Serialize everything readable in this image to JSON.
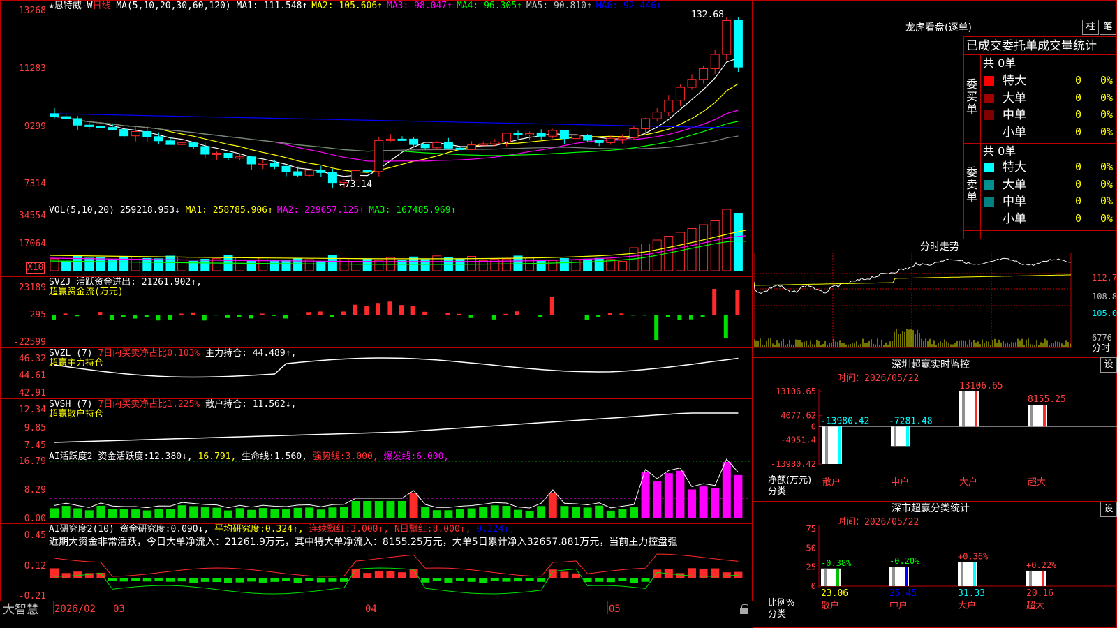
{
  "colors": {
    "up": "#ff2a2a",
    "down": "#00ffff",
    "grid": "#c00000",
    "ma1": "#ffffff",
    "ma2": "#ffff00",
    "ma3": "#ff00ff",
    "ma4": "#00ff00",
    "ma5": "#808080",
    "ma6": "#0000ff"
  },
  "main": {
    "star_title": "★思特威-W",
    "period": "日线",
    "ma_params": "MA(5,10,20,30,60,120)",
    "ma": [
      {
        "label": "MA1:",
        "value": "111.548↑",
        "color": "#ffffff"
      },
      {
        "label": "MA2:",
        "value": "105.606↑",
        "color": "#ffff00"
      },
      {
        "label": "MA3:",
        "value": "98.047↑",
        "color": "#ff00ff"
      },
      {
        "label": "MA4:",
        "value": "96.305↑",
        "color": "#00ff00"
      },
      {
        "label": "MA5:",
        "value": "90.810↑",
        "color": "#c0c0c0"
      },
      {
        "label": "MA6:",
        "value": "92.446↑",
        "color": "#0000ff"
      }
    ],
    "axis": [
      "13268",
      "11283",
      "9299",
      "7314"
    ],
    "high_label": "132.68",
    "low_label": "←73.14"
  },
  "vol": {
    "name": "VOL(5,10,20)",
    "value": "259218.953↓",
    "ma": [
      {
        "label": "MA1:",
        "value": "258785.906↑",
        "color": "#ffff00"
      },
      {
        "label": "MA2:",
        "value": "229657.125↑",
        "color": "#ff00ff"
      },
      {
        "label": "MA3:",
        "value": "167485.969↑",
        "color": "#00ff00"
      }
    ],
    "axis": [
      "34554",
      "17064"
    ],
    "unit": "X10"
  },
  "svzj": {
    "name": "SVZJ",
    "label": "活跃资金进出:",
    "value": "21261.902↑,",
    "sub": "超赢资金流(万元)",
    "axis": [
      "23189",
      "295",
      "-22599"
    ]
  },
  "svzl": {
    "name": "SVZL  (7)",
    "pct": "7日内买卖净占比0.103%",
    "label": "主力持仓:",
    "value": "44.489↑,",
    "sub": "超赢主力持仓",
    "axis": [
      "46.32",
      "44.61",
      "42.91"
    ]
  },
  "svsh": {
    "name": "SVSH  (7)",
    "pct": "7日内买卖净占比1.225%",
    "label": "散户持仓:",
    "value": "11.562↓,",
    "sub": "超赢散户持仓",
    "axis": [
      "12.34",
      "9.85",
      "7.45"
    ]
  },
  "ai1": {
    "name": "AI活跃度2",
    "l1": "资金活跃度:",
    "v1": "12.380↓,",
    "v2": "16.791,",
    "l3": "生命线:",
    "v3": "1.560,",
    "l4": "强势线:",
    "v4": "3.000,",
    "l5": "爆发线:",
    "v5": "6.000,",
    "axis": [
      "16.79",
      "8.29",
      "0.00"
    ]
  },
  "ai2": {
    "name": "AI研究度2(10)",
    "l1": "资金研究度:",
    "v1": "0.090↓,",
    "l2": "平均研究度:",
    "v2": "0.324↑,",
    "l3": "连续飘红:",
    "v3": "3.000↑,",
    "l4": "N日飘红:",
    "v4": "8.000↑,",
    "v5": "0.324↑,",
    "comment": "近期大资金非常活跃，今日大单净流入：21261.9万元，其中特大单净流入：8155.25万元，大单5日累计净入32657.881万元，当前主力控盘强",
    "axis": [
      "0.45",
      "0.12",
      "-0.21"
    ]
  },
  "xaxis": {
    "brand": "大智慧",
    "labels": [
      "2026/02",
      "03",
      "04",
      "05"
    ]
  },
  "right": {
    "lhkp_title": "龙虎看盘(逐单)",
    "btn1": "柱",
    "btn2": "笔",
    "stats_title": "已成交委托单成交量统计",
    "buy_label": "委买单",
    "sell_label": "委卖单",
    "buy_total": "共 0单",
    "sell_total": "共 0单",
    "buy_rows": [
      {
        "color": "#ff0000",
        "name": "特大",
        "count": "0",
        "pct": "0%"
      },
      {
        "color": "#a00000",
        "name": "大单",
        "count": "0",
        "pct": "0%"
      },
      {
        "color": "#800000",
        "name": "中单",
        "count": "0",
        "pct": "0%"
      },
      {
        "color": "",
        "name": "小单",
        "count": "0",
        "pct": "0%"
      }
    ],
    "sell_rows": [
      {
        "color": "#00ffff",
        "name": "特大",
        "count": "0",
        "pct": "0%"
      },
      {
        "color": "#009090",
        "name": "大单",
        "count": "0",
        "pct": "0%"
      },
      {
        "color": "#008080",
        "name": "中单",
        "count": "0",
        "pct": "0%"
      },
      {
        "color": "",
        "name": "小单",
        "count": "0",
        "pct": "0%"
      }
    ],
    "intraday_title": "分时走势",
    "intraday_axis": [
      "112.7",
      "108.8",
      "105.0",
      "6776"
    ],
    "intraday_unit": "分时",
    "sz_title": "深圳超赢实时监控",
    "set_btn": "设",
    "sz_time": "时间：2026/05/22",
    "sz_axis": [
      "13106.65",
      "4077.62",
      "0",
      "-4951.4",
      "-13980.42"
    ],
    "sz_axis_note": "净额(万元)",
    "sz_axis_note2": "分类",
    "sz_cats": [
      "散户",
      "中户",
      "大户",
      "超大"
    ],
    "sz_vals": [
      "-13980.42",
      "-7281.48",
      "13106.65",
      "8155.25"
    ],
    "sc_title": "深市超赢分类统计",
    "sc_set_btn": "设",
    "sc_time": "时间：2026/05/22",
    "sc_axis": [
      "75",
      "50",
      "25",
      "0"
    ],
    "sc_axis_note": "比例%",
    "sc_axis_note2": "分类",
    "sc_cats": [
      "散户",
      "中户",
      "大户",
      "超大"
    ],
    "sc_changes": [
      "-0.38%",
      "-0.20%",
      "+0.36%",
      "+0.22%"
    ],
    "sc_vals": [
      "23.06",
      "25.45",
      "31.33",
      "20.16"
    ]
  },
  "chart_data": [
    {
      "type": "bar",
      "title": "深圳超赢实时监控",
      "categories": [
        "散户",
        "中户",
        "大户",
        "超大"
      ],
      "values": [
        -13980.42,
        -7281.48,
        13106.65,
        8155.25
      ],
      "ylabel": "净额(万元)",
      "ylim": [
        -13980.42,
        13106.65
      ]
    },
    {
      "type": "bar",
      "title": "深市超赢分类统计",
      "categories": [
        "散户",
        "中户",
        "大户",
        "超大"
      ],
      "values": [
        23.06,
        25.45,
        31.33,
        20.16
      ],
      "ylabel": "比例%",
      "ylim": [
        0,
        75
      ]
    }
  ]
}
